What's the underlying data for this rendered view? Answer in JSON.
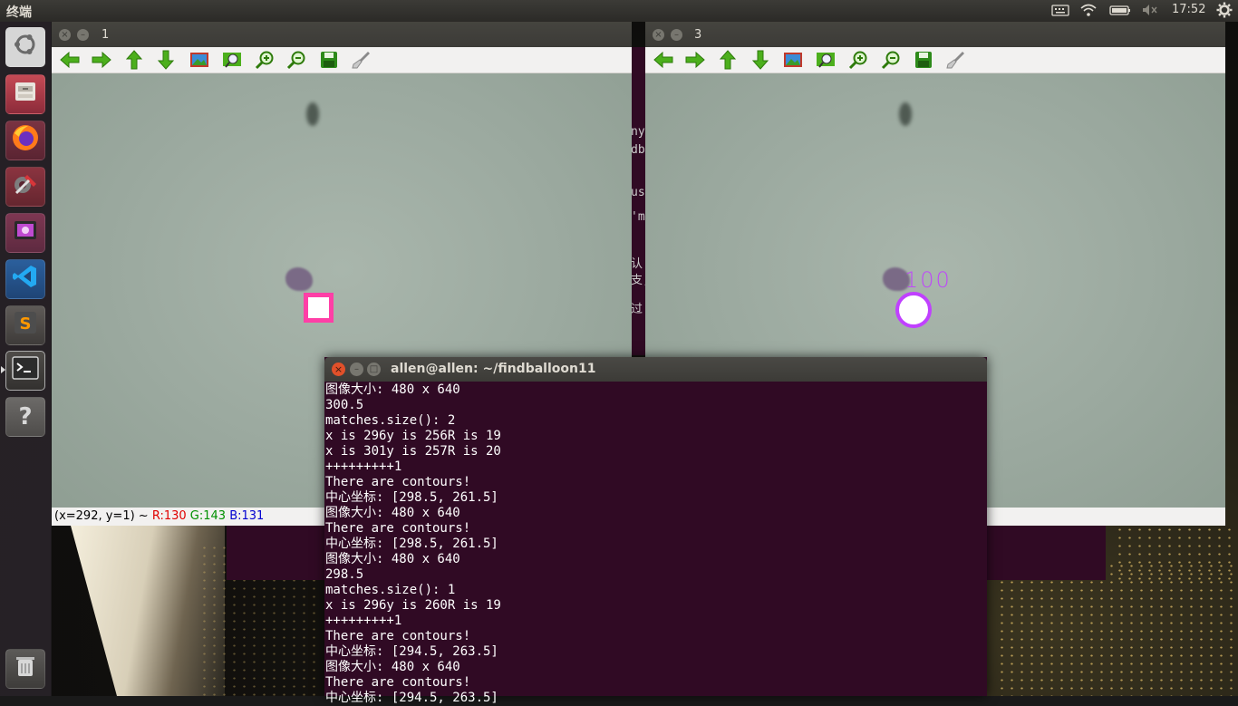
{
  "top_panel": {
    "app_title": "终端",
    "time": "17:52"
  },
  "launcher": {
    "items": [
      {
        "name": "ubuntu-dash",
        "glyph": "◉"
      },
      {
        "name": "files",
        "glyph": "▤"
      },
      {
        "name": "firefox",
        "glyph": "●"
      },
      {
        "name": "system-settings",
        "glyph": "✎"
      },
      {
        "name": "video-player",
        "glyph": "▣"
      },
      {
        "name": "vscode",
        "glyph": "⟩⟨"
      },
      {
        "name": "sublime-text",
        "glyph": "S"
      },
      {
        "name": "terminal",
        "glyph": ">_"
      },
      {
        "name": "help",
        "glyph": "?"
      },
      {
        "name": "trash",
        "glyph": "🗑"
      }
    ]
  },
  "window1": {
    "title": "1",
    "status": {
      "coords": "(x=292, y=1) ~ ",
      "r": "R:130",
      "g": "G:143",
      "b": "B:131"
    }
  },
  "window3": {
    "title": "3",
    "overlay_label": "100"
  },
  "terminal": {
    "title": "allen@allen: ~/findballoon11",
    "lines": [
      "图像大小: 480 x 640",
      "300.5",
      "matches.size(): 2",
      "x is 296y is 256R is 19",
      "x is 301y is 257R is 20",
      "+++++++++1",
      "There are contours!",
      "中心坐标: [298.5, 261.5]",
      "图像大小: 480 x 640",
      "There are contours!",
      "中心坐标: [298.5, 261.5]",
      "图像大小: 480 x 640",
      "298.5",
      "matches.size(): 1",
      "x is 296y is 260R is 19",
      "+++++++++1",
      "There are contours!",
      "中心坐标: [294.5, 263.5]",
      "图像大小: 480 x 640",
      "There are contours!",
      "中心坐标: [294.5, 263.5]"
    ]
  },
  "background_terminal": {
    "fragments": [
      "ny",
      "db",
      "us",
      "'m",
      "认",
      "支,",
      "过"
    ]
  },
  "colors": {
    "marker_square": "#ff3fa6",
    "marker_circle": "#c040ff",
    "terminal_bg": "#300a24",
    "status_r": "#e00000",
    "status_g": "#009000",
    "status_b": "#0000d0"
  }
}
